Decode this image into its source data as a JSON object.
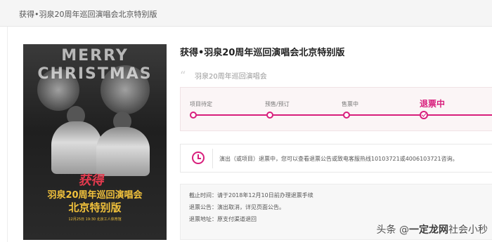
{
  "header": {
    "breadcrumb": "获得•羽泉20周年巡回演唱会北京特别版"
  },
  "poster": {
    "xmas_text": "MERRY CHRISTMAS",
    "logo": "获得",
    "title_line1": "羽泉20周年巡回演唱会",
    "title_line2": "北京特别版",
    "meta": "12月25日 19:30 北京工人体育馆"
  },
  "show": {
    "title": "获得•羽泉20周年巡回演唱会北京特别版",
    "subtitle": "羽泉20周年巡回演唱会"
  },
  "progress": {
    "steps": [
      {
        "label": "项目待定"
      },
      {
        "label": "预售/预订"
      },
      {
        "label": "售票中"
      },
      {
        "label": "退票中"
      }
    ],
    "active_index": 3,
    "accent": "#d81e7c"
  },
  "notice": {
    "icon": "clock-icon",
    "text": "演出（或项目）退票中，您可以查看退票公告或致电客服热线10103721或4006103721咨询。"
  },
  "refund_info": {
    "deadline_label": "截止时间：",
    "deadline_value": "请于2018年12月10日前办理退票手续",
    "announcement_label": "退票公告：",
    "announcement_value": "演出取消，详见页面公告。",
    "address_label": "退票地址：",
    "address_value": "原支付渠道退回"
  },
  "watermark": {
    "prefix": "头条 @",
    "brand": "一定龙网",
    "suffix": "社会小秒"
  }
}
